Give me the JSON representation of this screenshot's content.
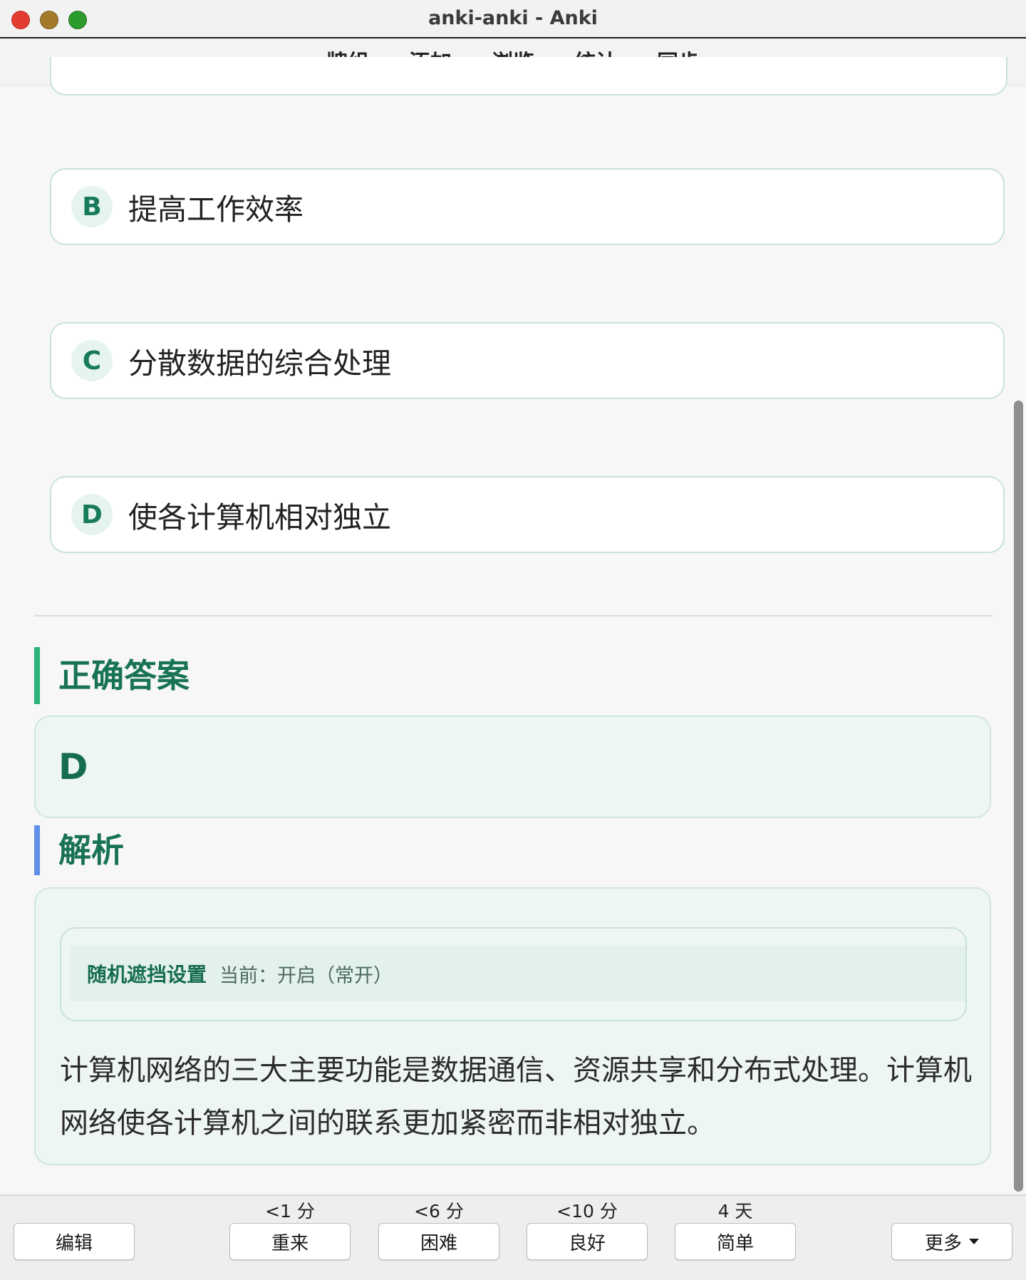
{
  "window": {
    "title": "anki-anki - Anki"
  },
  "nav": {
    "items": [
      "牌组",
      "添加",
      "浏览",
      "统计",
      "同步"
    ]
  },
  "options": [
    {
      "letter": "B",
      "text": "提高工作效率"
    },
    {
      "letter": "C",
      "text": "分散数据的综合处理"
    },
    {
      "letter": "D",
      "text": "使各计算机相对独立"
    }
  ],
  "answer": {
    "title": "正确答案",
    "value": "D"
  },
  "analysis": {
    "title": "解析",
    "mask_label": "随机遮挡设置",
    "mask_status": "当前：开启（常开）",
    "text": "计算机网络的三大主要功能是数据通信、资源共享和分布式处理。计算机网络使各计算机之间的联系更加紧密而非相对独立。"
  },
  "bottom": {
    "edit_label": "编辑",
    "more_label": "更多",
    "ease": [
      {
        "time": "<1 分",
        "label": "重来"
      },
      {
        "time": "<6 分",
        "label": "困难"
      },
      {
        "time": "<10 分",
        "label": "良好"
      },
      {
        "time": "4 天",
        "label": "简单"
      }
    ]
  }
}
